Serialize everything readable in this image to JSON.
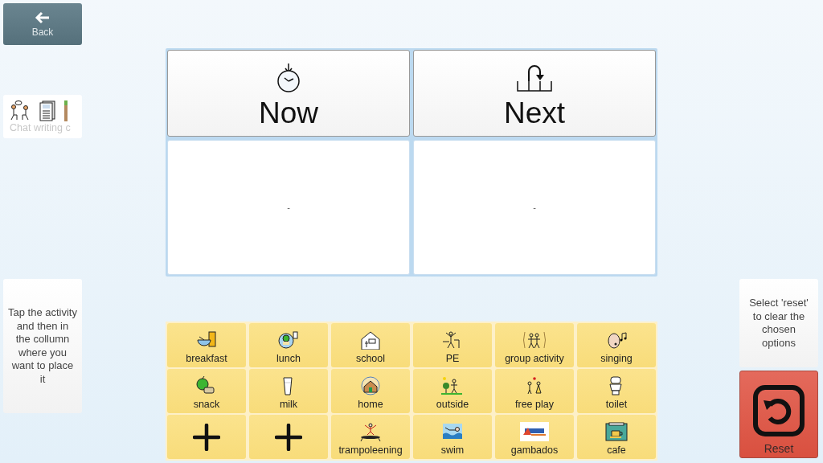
{
  "back_button": {
    "label": "Back"
  },
  "board_link": {
    "label": "Chat writing c"
  },
  "left_hint": "Tap the activity and then in the collumn where you want to place it",
  "board": {
    "columns": [
      {
        "title": "Now",
        "slot": "-"
      },
      {
        "title": "Next",
        "slot": "-"
      }
    ]
  },
  "activities": [
    {
      "kind": "symbol",
      "label": "breakfast"
    },
    {
      "kind": "symbol",
      "label": "lunch"
    },
    {
      "kind": "symbol",
      "label": "school"
    },
    {
      "kind": "symbol",
      "label": "PE"
    },
    {
      "kind": "symbol",
      "label": "group activity"
    },
    {
      "kind": "symbol",
      "label": "singing"
    },
    {
      "kind": "symbol",
      "label": "snack"
    },
    {
      "kind": "symbol",
      "label": "milk"
    },
    {
      "kind": "symbol",
      "label": "home"
    },
    {
      "kind": "symbol",
      "label": "outside"
    },
    {
      "kind": "symbol",
      "label": "free play"
    },
    {
      "kind": "symbol",
      "label": "toilet"
    },
    {
      "kind": "add"
    },
    {
      "kind": "add"
    },
    {
      "kind": "symbol",
      "label": "trampoleening"
    },
    {
      "kind": "symbol",
      "label": "swim"
    },
    {
      "label": "gambados"
    },
    {
      "kind": "symbol",
      "label": "cafe"
    }
  ],
  "right_hint": "Select 'reset' to clear the chosen options",
  "reset_button": {
    "label": "Reset"
  }
}
